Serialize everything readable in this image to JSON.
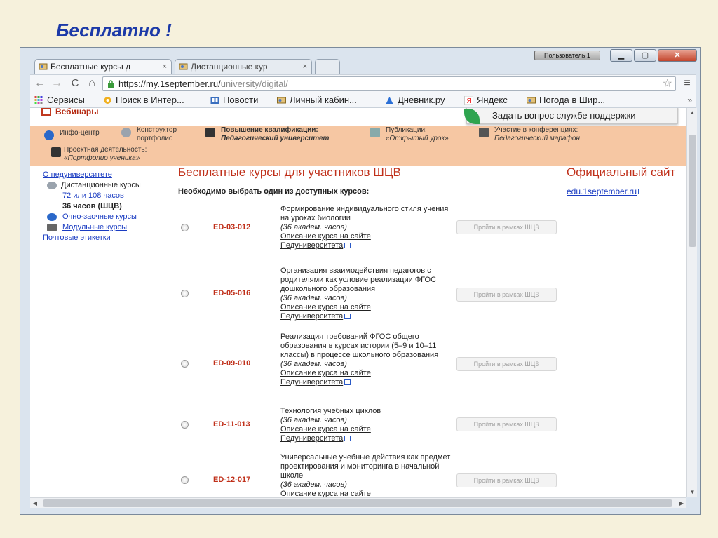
{
  "slide": {
    "title": "Бесплатно !"
  },
  "window": {
    "user_badge": "Пользователь 1",
    "min_label": "▁",
    "max_label": "▢",
    "close_label": "✕"
  },
  "tabs": [
    {
      "label": "Бесплатные курсы д",
      "close": "×"
    },
    {
      "label": "Дистанционные кур",
      "close": "×"
    }
  ],
  "toolbar": {
    "back": "←",
    "forward": "→",
    "reload": "C",
    "home": "⌂",
    "url_host": "https://my.1september.ru/",
    "url_rest": "university/digital/",
    "star": "☆",
    "menu": "≡"
  },
  "bookmarks": {
    "items": [
      {
        "label": "Сервисы"
      },
      {
        "label": "Поиск в Интер..."
      },
      {
        "label": "Новости"
      },
      {
        "label": "Личный кабин..."
      },
      {
        "label": "Дневник.ру"
      },
      {
        "label": "Яндекс"
      },
      {
        "label": "Погода в Шир..."
      }
    ],
    "more": "»"
  },
  "page": {
    "webinars": "Вебинары",
    "support": "Задать вопрос службе поддержки",
    "band": {
      "info": "Инфо-центр",
      "constructor_1": "Конструктор",
      "constructor_2": "портфолио",
      "qualification_1": "Повышение квалификации:",
      "qualification_2": "Педагогический университет",
      "publications_1": "Публикации:",
      "publications_2": "«Открытый урок»",
      "conferences_1": "Участие в конференциях:",
      "conferences_2": "Педагогический марафон",
      "project_1": "Проектная деятельность:",
      "project_2": "«Портфолио ученика»"
    },
    "sidebar": {
      "about": "О педуниверситете",
      "distance": "Дистанционные курсы",
      "hours_72_108": "72 или 108 часов",
      "hours_36": "36 часов (ШЦВ)",
      "fulltime": "Очно-заочные курсы",
      "modular": "Модульные курсы",
      "labels": "Почтовые этикетки"
    },
    "main_title": "Бесплатные курсы для участников ШЦВ",
    "main_sub": "Необходимо выбрать один из доступных курсов:",
    "official_title": "Официальный сайт",
    "official_link": "edu.1september.ru",
    "courses": [
      {
        "code": "ED-03-012",
        "title": "Формирование индивидуального стиля учения на уроках биологии",
        "hours": "(36 академ. часов)",
        "link1": "Описание курса на сайте",
        "link2": "Педуниверситета",
        "button": "Пройти в рамках ШЦВ"
      },
      {
        "code": "ED-05-016",
        "title": "Организация взаимодействия педагогов с родителями как условие реализации ФГОС дошкольного образования",
        "hours": "(36 академ. часов)",
        "link1": "Описание курса на сайте",
        "link2": "Педуниверситета",
        "button": "Пройти в рамках ШЦВ"
      },
      {
        "code": "ED-09-010",
        "title": "Реализация требований ФГОС общего образования в курсах истории (5–9 и 10–11 классы) в процессе школьного образования",
        "hours": "(36 академ. часов)",
        "link1": "Описание курса на сайте",
        "link2": "Педуниверситета",
        "button": "Пройти в рамках ШЦВ"
      },
      {
        "code": "ED-11-013",
        "title": "Технология учебных циклов",
        "hours": "(36 академ. часов)",
        "link1": "Описание курса на сайте",
        "link2": "Педуниверситета",
        "button": "Пройти в рамках ШЦВ"
      },
      {
        "code": "ED-12-017",
        "title": "Универсальные учебные действия как предмет проектирования и мониторинга в начальной школе",
        "hours": "(36 академ. часов)",
        "link1": "Описание курса на сайте",
        "link2": "",
        "button": "Пройти в рамках ШЦВ"
      }
    ]
  },
  "colors": {
    "accent_red": "#c0301a",
    "link_blue": "#1a3cc2",
    "band_orange": "#f6c7a3",
    "slide_title": "#1c3aa8"
  }
}
